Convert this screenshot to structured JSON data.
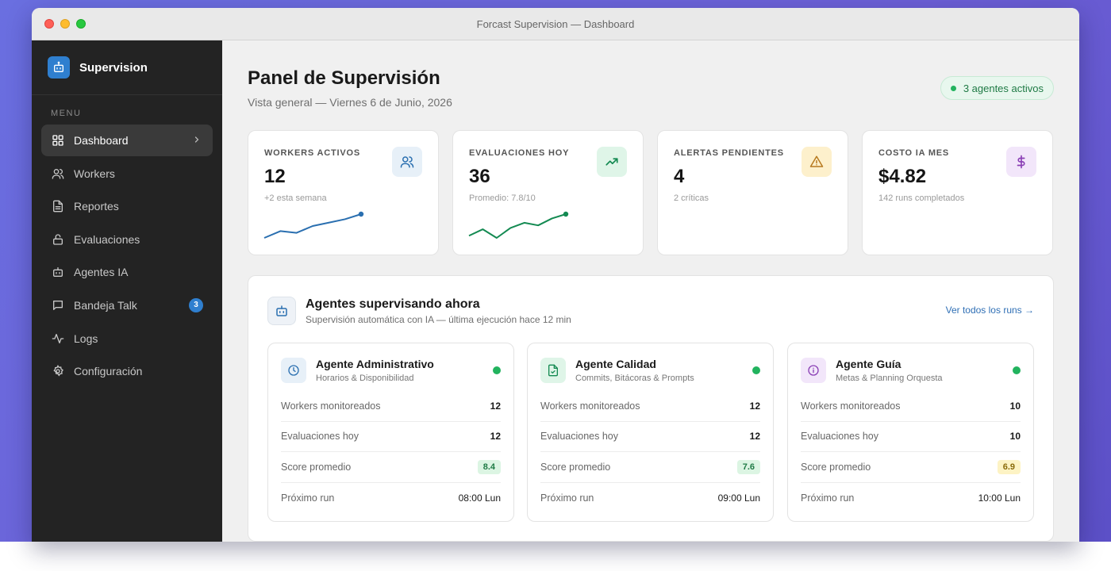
{
  "window": {
    "title": "Forcast Supervision — Dashboard"
  },
  "sidebar": {
    "brand": "Supervision",
    "menu_label": "MENU",
    "items": [
      {
        "label": "Dashboard",
        "icon": "grid-icon",
        "active": true
      },
      {
        "label": "Workers",
        "icon": "users-icon"
      },
      {
        "label": "Reportes",
        "icon": "document-icon"
      },
      {
        "label": "Evaluaciones",
        "icon": "lock-icon"
      },
      {
        "label": "Agentes IA",
        "icon": "robot-icon"
      },
      {
        "label": "Bandeja Talk",
        "icon": "chat-icon",
        "badge": "3"
      },
      {
        "label": "Logs",
        "icon": "activity-icon"
      },
      {
        "label": "Configuración",
        "icon": "gear-icon"
      }
    ]
  },
  "header": {
    "title": "Panel de Supervisión",
    "subtitle": "Vista general — Viernes 6 de Junio, 2026",
    "status": "3 agentes activos"
  },
  "stats": [
    {
      "label": "WORKERS ACTIVOS",
      "value": "12",
      "note": "+2 esta semana",
      "icon": "users-icon",
      "accent": "#2a6fb0",
      "bg": "#e7f0f8"
    },
    {
      "label": "EVALUACIONES HOY",
      "value": "36",
      "note": "Promedio: 7.8/10",
      "icon": "trending-up-icon",
      "accent": "#148a52",
      "bg": "#dff5e8"
    },
    {
      "label": "ALERTAS PENDIENTES",
      "value": "4",
      "note": "2 críticas",
      "icon": "warning-icon",
      "accent": "#b7791f",
      "bg": "#fdf0cc"
    },
    {
      "label": "COSTO IA MES",
      "value": "$4.82",
      "note": "142 runs completados",
      "icon": "dollar-icon",
      "accent": "#8a3fb5",
      "bg": "#f2e6fa"
    }
  ],
  "sparklines": [
    {
      "values": [
        3,
        5,
        4.5,
        6.5,
        7.5,
        8.5,
        10
      ]
    },
    {
      "values": [
        5,
        6.5,
        4.5,
        6.8,
        8,
        7.4,
        9,
        10
      ]
    }
  ],
  "panel": {
    "title": "Agentes supervisando ahora",
    "subtitle": "Supervisión automática con IA — última ejecución hace 12 min",
    "link": "Ver todos los runs →"
  },
  "agents": [
    {
      "name": "Agente Administrativo",
      "desc": "Horarios & Disponibilidad",
      "icon": "clock-icon",
      "accent": "#2a6fb0",
      "bg": "#e7f0f8",
      "rows": [
        {
          "label": "Workers monitoreados",
          "value": "12"
        },
        {
          "label": "Evaluaciones hoy",
          "value": "12"
        },
        {
          "label": "Score promedio",
          "value": "8.4",
          "chip_bg": "#dcf5e3",
          "chip_fg": "#1f7a45"
        },
        {
          "label": "Próximo run",
          "value": "08:00 Lun"
        }
      ]
    },
    {
      "name": "Agente Calidad",
      "desc": "Commits, Bitácoras & Prompts",
      "icon": "file-check-icon",
      "accent": "#148a52",
      "bg": "#dff5e8",
      "rows": [
        {
          "label": "Workers monitoreados",
          "value": "12"
        },
        {
          "label": "Evaluaciones hoy",
          "value": "12"
        },
        {
          "label": "Score promedio",
          "value": "7.6",
          "chip_bg": "#dcf5e3",
          "chip_fg": "#1f7a45"
        },
        {
          "label": "Próximo run",
          "value": "09:00 Lun"
        }
      ]
    },
    {
      "name": "Agente Guía",
      "desc": "Metas & Planning Orquesta",
      "icon": "info-circle-icon",
      "accent": "#8a3fb5",
      "bg": "#f2e6fa",
      "rows": [
        {
          "label": "Workers monitoreados",
          "value": "10"
        },
        {
          "label": "Evaluaciones hoy",
          "value": "10"
        },
        {
          "label": "Score promedio",
          "value": "6.9",
          "chip_bg": "#fdf3c4",
          "chip_fg": "#8a6a0a"
        },
        {
          "label": "Próximo run",
          "value": "10:00 Lun"
        }
      ]
    }
  ]
}
